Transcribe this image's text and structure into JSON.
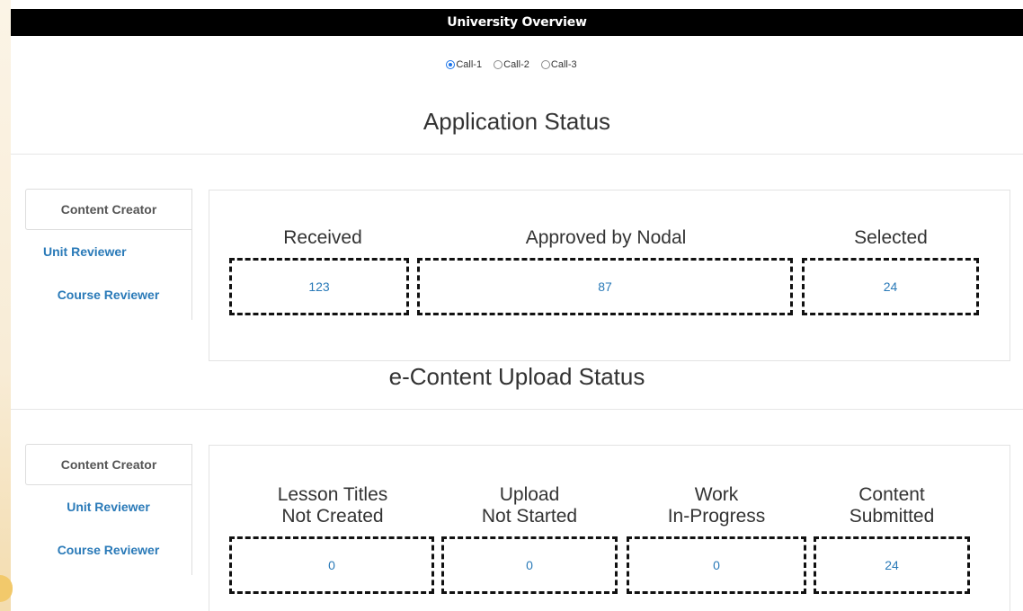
{
  "page": {
    "title": "University Overview"
  },
  "calls": {
    "selected": "Call-1",
    "options": [
      {
        "label": "Call-1",
        "checked": true
      },
      {
        "label": "Call-2",
        "checked": false
      },
      {
        "label": "Call-3",
        "checked": false
      }
    ]
  },
  "application_status": {
    "heading": "Application Status",
    "tabs": [
      {
        "label": "Content Creator",
        "active": true
      },
      {
        "label": "Unit Reviewer",
        "active": false
      },
      {
        "label": "Course Reviewer",
        "active": false
      }
    ],
    "stats": [
      {
        "label": "Received",
        "value": "123"
      },
      {
        "label": "Approved by Nodal",
        "value": "87"
      },
      {
        "label": "Selected",
        "value": "24"
      }
    ]
  },
  "econtent_status": {
    "heading": "e-Content Upload Status",
    "tabs": [
      {
        "label": "Content Creator",
        "active": true
      },
      {
        "label": "Unit Reviewer",
        "active": false
      },
      {
        "label": "Course Reviewer",
        "active": false
      }
    ],
    "stats": [
      {
        "label_line1": "Lesson Titles",
        "label_line2": "Not Created",
        "value": "0"
      },
      {
        "label_line1": "Upload",
        "label_line2": "Not Started",
        "value": "0"
      },
      {
        "label_line1": "Work",
        "label_line2": "In-Progress",
        "value": "0"
      },
      {
        "label_line1": "Content",
        "label_line2": "Submitted",
        "value": "24"
      }
    ]
  }
}
